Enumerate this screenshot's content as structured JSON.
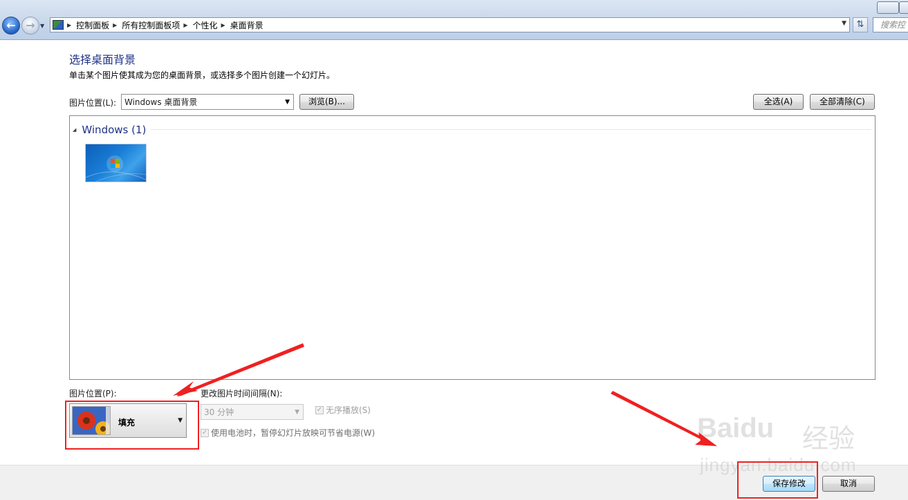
{
  "address": {
    "crumbs": [
      "控制面板",
      "所有控制面板项",
      "个性化",
      "桌面背景"
    ],
    "search_placeholder": "搜索控"
  },
  "header": {
    "title": "选择桌面背景",
    "description": "单击某个图片使其成为您的桌面背景，或选择多个图片创建一个幻灯片。"
  },
  "location": {
    "label": "图片位置(L):",
    "value": "Windows 桌面背景",
    "browse_label": "浏览(B)...",
    "select_all_label": "全选(A)",
    "clear_all_label": "全部清除(C)"
  },
  "gallery": {
    "group_title": "Windows (1)"
  },
  "options": {
    "position_label": "图片位置(P):",
    "position_value": "填充",
    "interval_label": "更改图片时间间隔(N):",
    "interval_value": "30 分钟",
    "shuffle_label": "无序播放(S)",
    "battery_label": "使用电池时，暂停幻灯片放映可节省电源(W)"
  },
  "footer": {
    "save_label": "保存修改",
    "cancel_label": "取消"
  },
  "watermark": {
    "brand": "Baidu",
    "brand_cn": "经验",
    "url": "jingyan.baidu.com"
  },
  "colors": {
    "title_blue": "#1e3287",
    "annotation_red": "#f02020"
  },
  "icons": [
    "back-arrow-icon",
    "forward-arrow-icon",
    "control-panel-icon",
    "refresh-icon",
    "chevron-down-icon"
  ]
}
